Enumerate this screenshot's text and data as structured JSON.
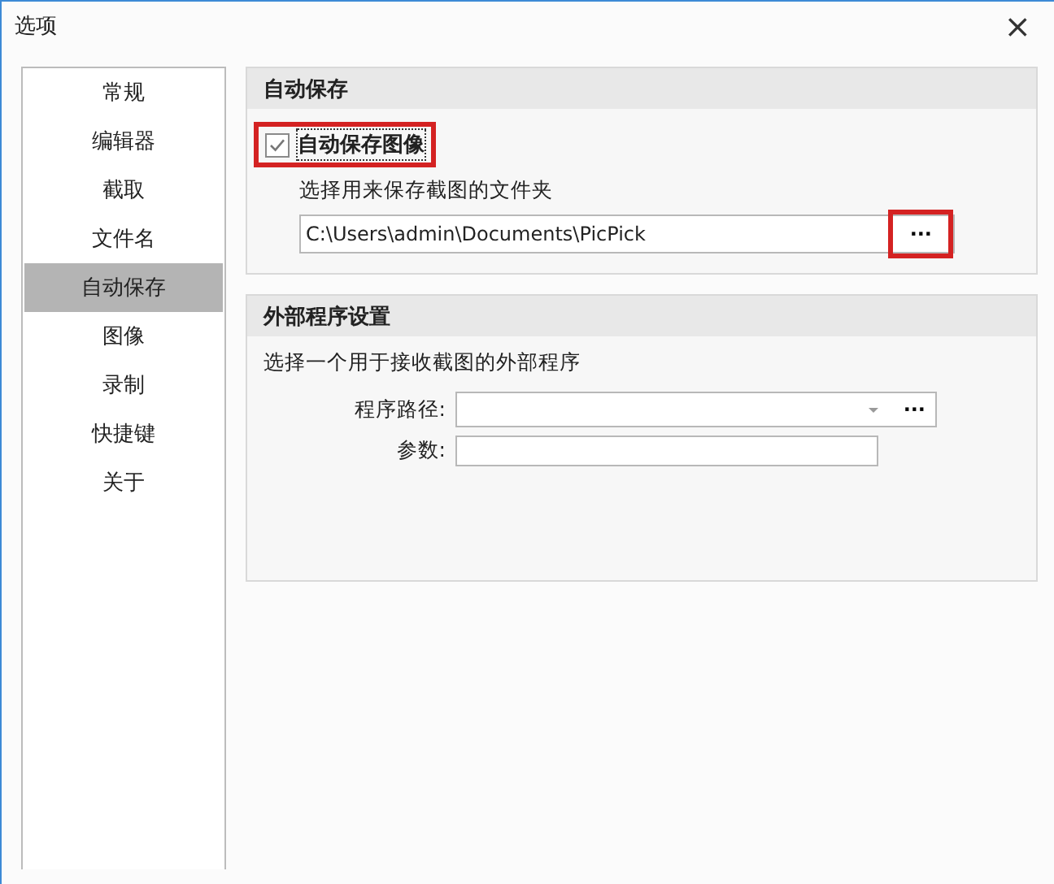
{
  "window": {
    "title": "选项",
    "close": "×"
  },
  "sidebar": {
    "items": [
      {
        "label": "常规",
        "selected": false
      },
      {
        "label": "编辑器",
        "selected": false
      },
      {
        "label": "截取",
        "selected": false
      },
      {
        "label": "文件名",
        "selected": false
      },
      {
        "label": "自动保存",
        "selected": true
      },
      {
        "label": "图像",
        "selected": false
      },
      {
        "label": "录制",
        "selected": false
      },
      {
        "label": "快捷键",
        "selected": false
      },
      {
        "label": "关于",
        "selected": false
      }
    ]
  },
  "auto_save": {
    "title": "自动保存",
    "checkbox": {
      "label": "自动保存图像",
      "checked": true,
      "highlighted": true
    },
    "folder_label": "选择用来保存截图的文件夹",
    "folder_path": "C:\\Users\\admin\\Documents\\PicPick",
    "browse": {
      "label": "···",
      "highlighted": true
    }
  },
  "external_program": {
    "title": "外部程序设置",
    "description": "选择一个用于接收截图的外部程序",
    "path_label": "程序路径:",
    "browse": {
      "label": "···",
      "highlighted": false
    },
    "params_label": "参数:"
  }
}
